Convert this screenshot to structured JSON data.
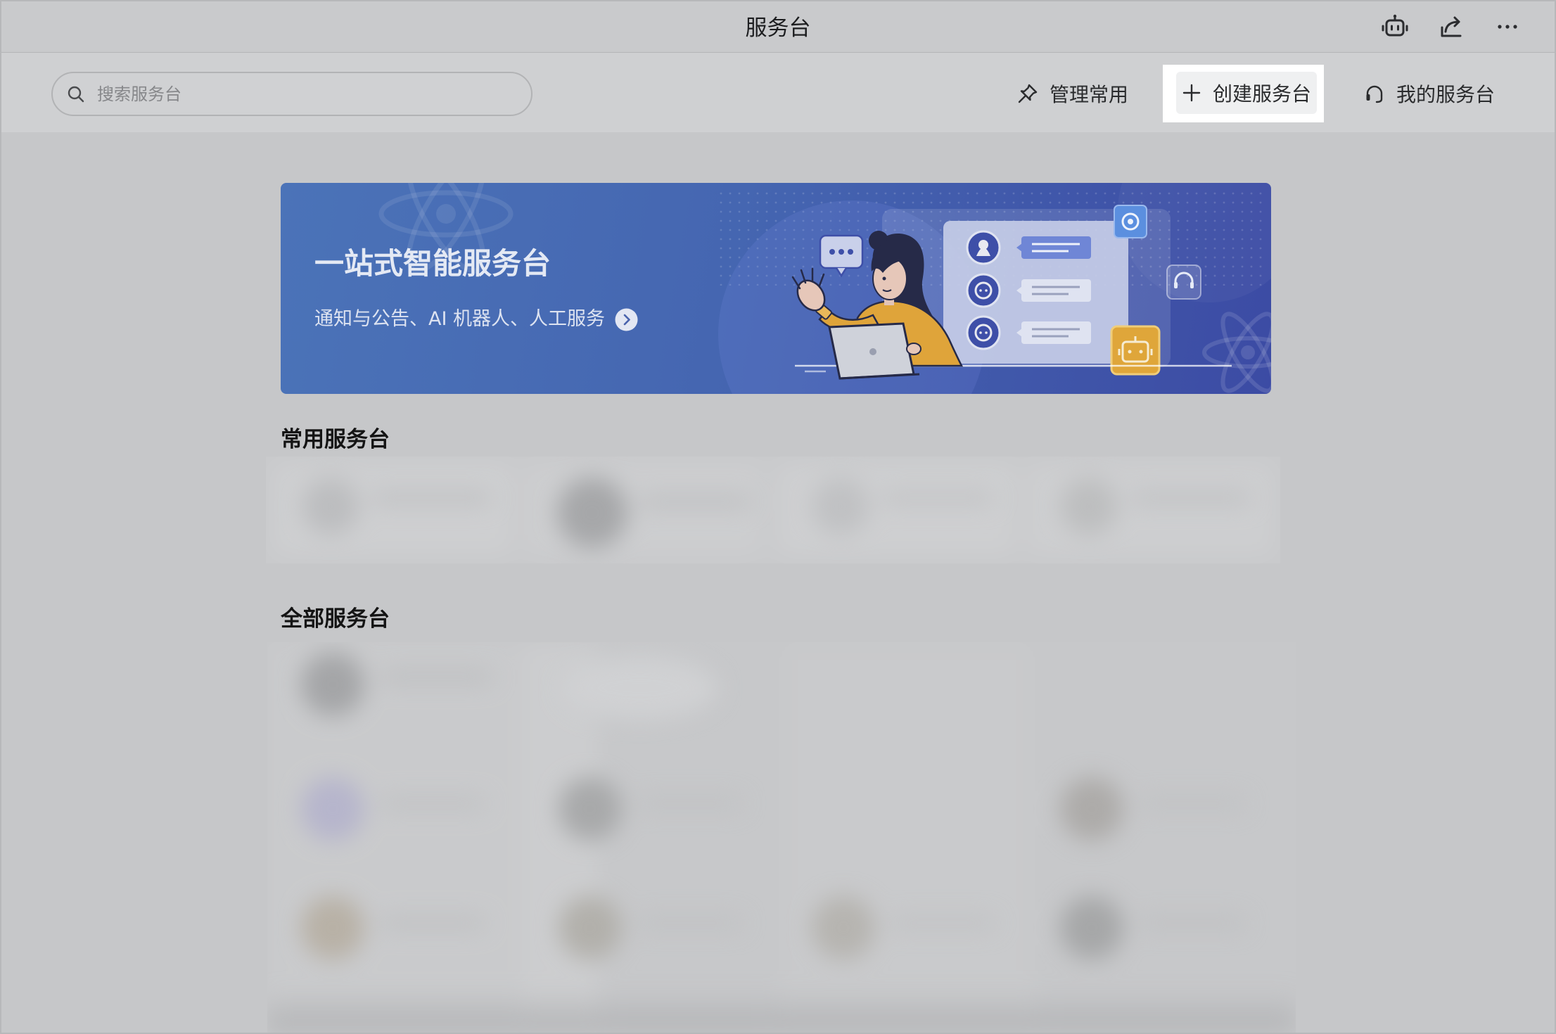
{
  "window": {
    "title": "服务台"
  },
  "titlebar_icons": {
    "bot": "robot-icon",
    "share": "share-icon",
    "more": "more-icon"
  },
  "toolbar": {
    "search": {
      "placeholder": "搜索服务台",
      "value": "",
      "icon": "search-icon"
    },
    "manage": {
      "label": "管理常用",
      "icon": "pin-icon"
    },
    "create": {
      "label": "创建服务台",
      "icon": "plus-icon"
    },
    "my": {
      "label": "我的服务台",
      "icon": "headset-icon"
    }
  },
  "banner": {
    "title": "一站式智能服务台",
    "subtitle": "通知与公告、AI 机器人、人工服务",
    "link_icon": "chevron-right-icon"
  },
  "sections": {
    "frequent": {
      "title": "常用服务台"
    },
    "all": {
      "title": "全部服务台"
    }
  },
  "colors": {
    "page_dimmed": "#c6c7c9",
    "highlight": "#ffffff",
    "banner_from": "#4b73b8",
    "banner_to": "#3c4ba4",
    "robot_badge": "#dfa63a",
    "avatar": "#3e4fa8"
  }
}
